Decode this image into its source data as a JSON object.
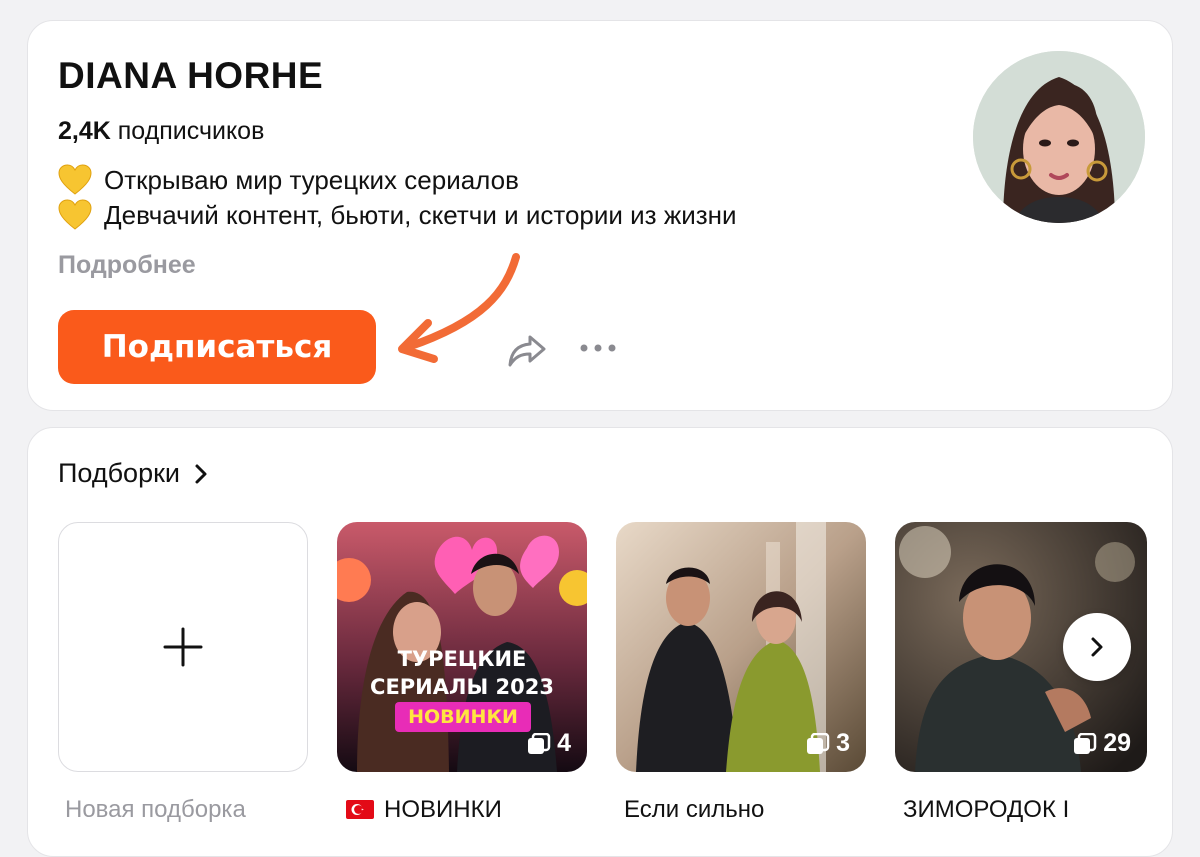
{
  "profile": {
    "name": "DIANA HORHE",
    "subscribers_count": "2,4K",
    "subscribers_label": "подписчиков",
    "bio": [
      "Открываю мир турецких сериалов",
      "Девчачий контент, бьюти, скетчи и истории из жизни"
    ],
    "more_link": "Подробнее",
    "subscribe_label": "Подписаться",
    "accent_color": "#fa5a1b"
  },
  "collections": {
    "title": "Подборки",
    "new_label": "Новая подборка",
    "items": [
      {
        "label": "НОВИНКИ",
        "count": "4",
        "poster_title_1": "ТУРЕЦКИЕ",
        "poster_title_2": "СЕРИАЛЫ 2023",
        "poster_badge": "НОВИНКИ"
      },
      {
        "label": "Если сильно",
        "count": "3"
      },
      {
        "label": "ЗИМОРОДОК I",
        "count": "29"
      }
    ]
  },
  "icons": [
    "yellow-heart-icon",
    "share-icon",
    "more-dots-icon",
    "chevron-right-icon",
    "plus-icon",
    "stack-icon",
    "turkey-flag-icon"
  ]
}
